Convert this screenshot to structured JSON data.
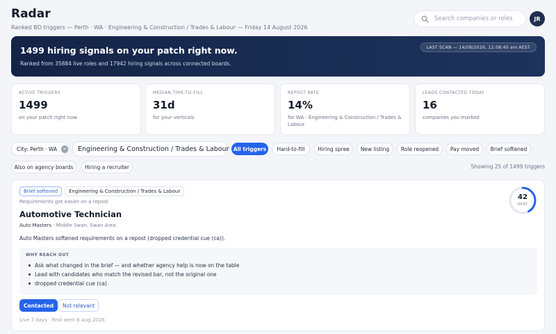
{
  "header": {
    "title": "Radar",
    "subtitle": "Ranked BD triggers — Perth · WA · Engineering & Construction / Trades & Labour — Friday 14 August 2026",
    "search_placeholder": "Search companies or roles",
    "avatar_initials": "JR"
  },
  "hero": {
    "title": "1499 hiring signals on your patch right now.",
    "subtitle": "Ranked from 35884 live roles and 17942 hiring signals across connected boards.",
    "last_scan": "LAST SCAN — 14/08/2026, 12:08:40 am AEST"
  },
  "stats": [
    {
      "label": "ACTIVE TRIGGERS",
      "value": "1499",
      "note": "on your patch right now"
    },
    {
      "label": "MEDIAN TIME-TO-FILL",
      "value": "31d",
      "note": "for your verticals"
    },
    {
      "label": "REPOST RATE",
      "value": "14%",
      "note": "for WA · Engineering & Construction / Trades & Labour"
    },
    {
      "label": "LEADS CONTACTED TODAY",
      "value": "16",
      "note": "companies you marked"
    }
  ],
  "filters": {
    "city": "City: Perth · WA",
    "sector": "Engineering & Construction / Trades & Labour",
    "trigger_types": [
      "All triggers",
      "Hard-to-fill",
      "Hiring spree",
      "New listing",
      "Role reopened",
      "Pay moved",
      "Brief softened",
      "Also on agency boards",
      "Hiring a recruiter"
    ],
    "active_trigger": "All triggers",
    "showing": "Showing 25 of 1499 triggers"
  },
  "card": {
    "tag": "Brief softened",
    "sector_tag": "Engineering & Construction / Trades & Labour",
    "caption": "Requirements got easier on a repost",
    "role": "Automotive Technician",
    "company": "Auto Masters",
    "location": " · Middle Swan, Swan Area",
    "description": "Auto Masters softened requirements on a repost (dropped credential cue (ca)).",
    "reach_out_label": "WHY REACH OUT",
    "reach_out_points": [
      "Ask what changed in the brief — and whether agency help is now on the table",
      "Lead with candidates who match the revised bar, not the original one",
      "dropped credential cue (ca)"
    ],
    "contacted_label": "Contacted",
    "not_relevant_label": "Not relevant",
    "meta": "Live 7 days · First seen 6 Aug 2026",
    "heat_value": "42",
    "heat_label": "HEAT",
    "heat_score": 42,
    "heat_max": 100,
    "heat_color": "#2563eb"
  }
}
